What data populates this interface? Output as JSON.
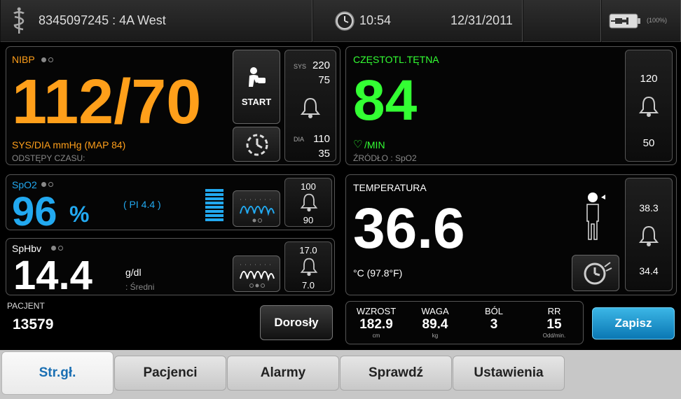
{
  "topbar": {
    "patient": "8345097245 : 4A West",
    "time": "10:54",
    "date": "12/31/2011",
    "battery_pct": "(100%)"
  },
  "nibp": {
    "label": "NIBP",
    "value": "112/70",
    "units": "SYS/DIA mmHg (MAP 84)",
    "interval": "ODSTĘPY CZASU:",
    "start_label": "START",
    "sys_label": "SYS",
    "sys_high": "220",
    "sys_low": "75",
    "dia_label": "DIA",
    "dia_high": "110",
    "dia_low": "35"
  },
  "pulse": {
    "label": "CZĘSTOTL.TĘTNA",
    "value": "84",
    "units": "/MIN",
    "source": "ŹRÓDŁO : SpO2",
    "high": "120",
    "low": "50"
  },
  "spo2": {
    "label": "SpO2",
    "value": "96",
    "units": "%",
    "pi": "( PI 4.4 )",
    "high": "100",
    "low": "90"
  },
  "sphb": {
    "label": "SpHbv",
    "value": "14.4",
    "units": "g/dl",
    "mode": ": Średni",
    "high": "17.0",
    "low": "7.0"
  },
  "temperature": {
    "label": "TEMPERATURA",
    "value": "36.6",
    "units": "°C (97.8°F)",
    "high": "38.3",
    "low": "34.4"
  },
  "patient": {
    "label": "PACJENT",
    "id": "13579",
    "type_button": "Dorosły"
  },
  "manual": [
    {
      "label": "WZROST",
      "value": "182.9",
      "unit": "cm"
    },
    {
      "label": "WAGA",
      "value": "89.4",
      "unit": "kg"
    },
    {
      "label": "BÓL",
      "value": "3",
      "unit": ""
    },
    {
      "label": "RR",
      "value": "15",
      "unit": "Odd/min."
    }
  ],
  "save_button": "Zapisz",
  "tabs": [
    {
      "label": "Str.gł.",
      "active": true
    },
    {
      "label": "Pacjenci",
      "active": false
    },
    {
      "label": "Alarmy",
      "active": false
    },
    {
      "label": "Sprawdź",
      "active": false
    },
    {
      "label": "Ustawienia",
      "active": false
    }
  ],
  "colors": {
    "nibp": "#ff9f1a",
    "pulse": "#33ff33",
    "spo2": "#22a9f0",
    "accent_blue": "#1a6fb3"
  }
}
